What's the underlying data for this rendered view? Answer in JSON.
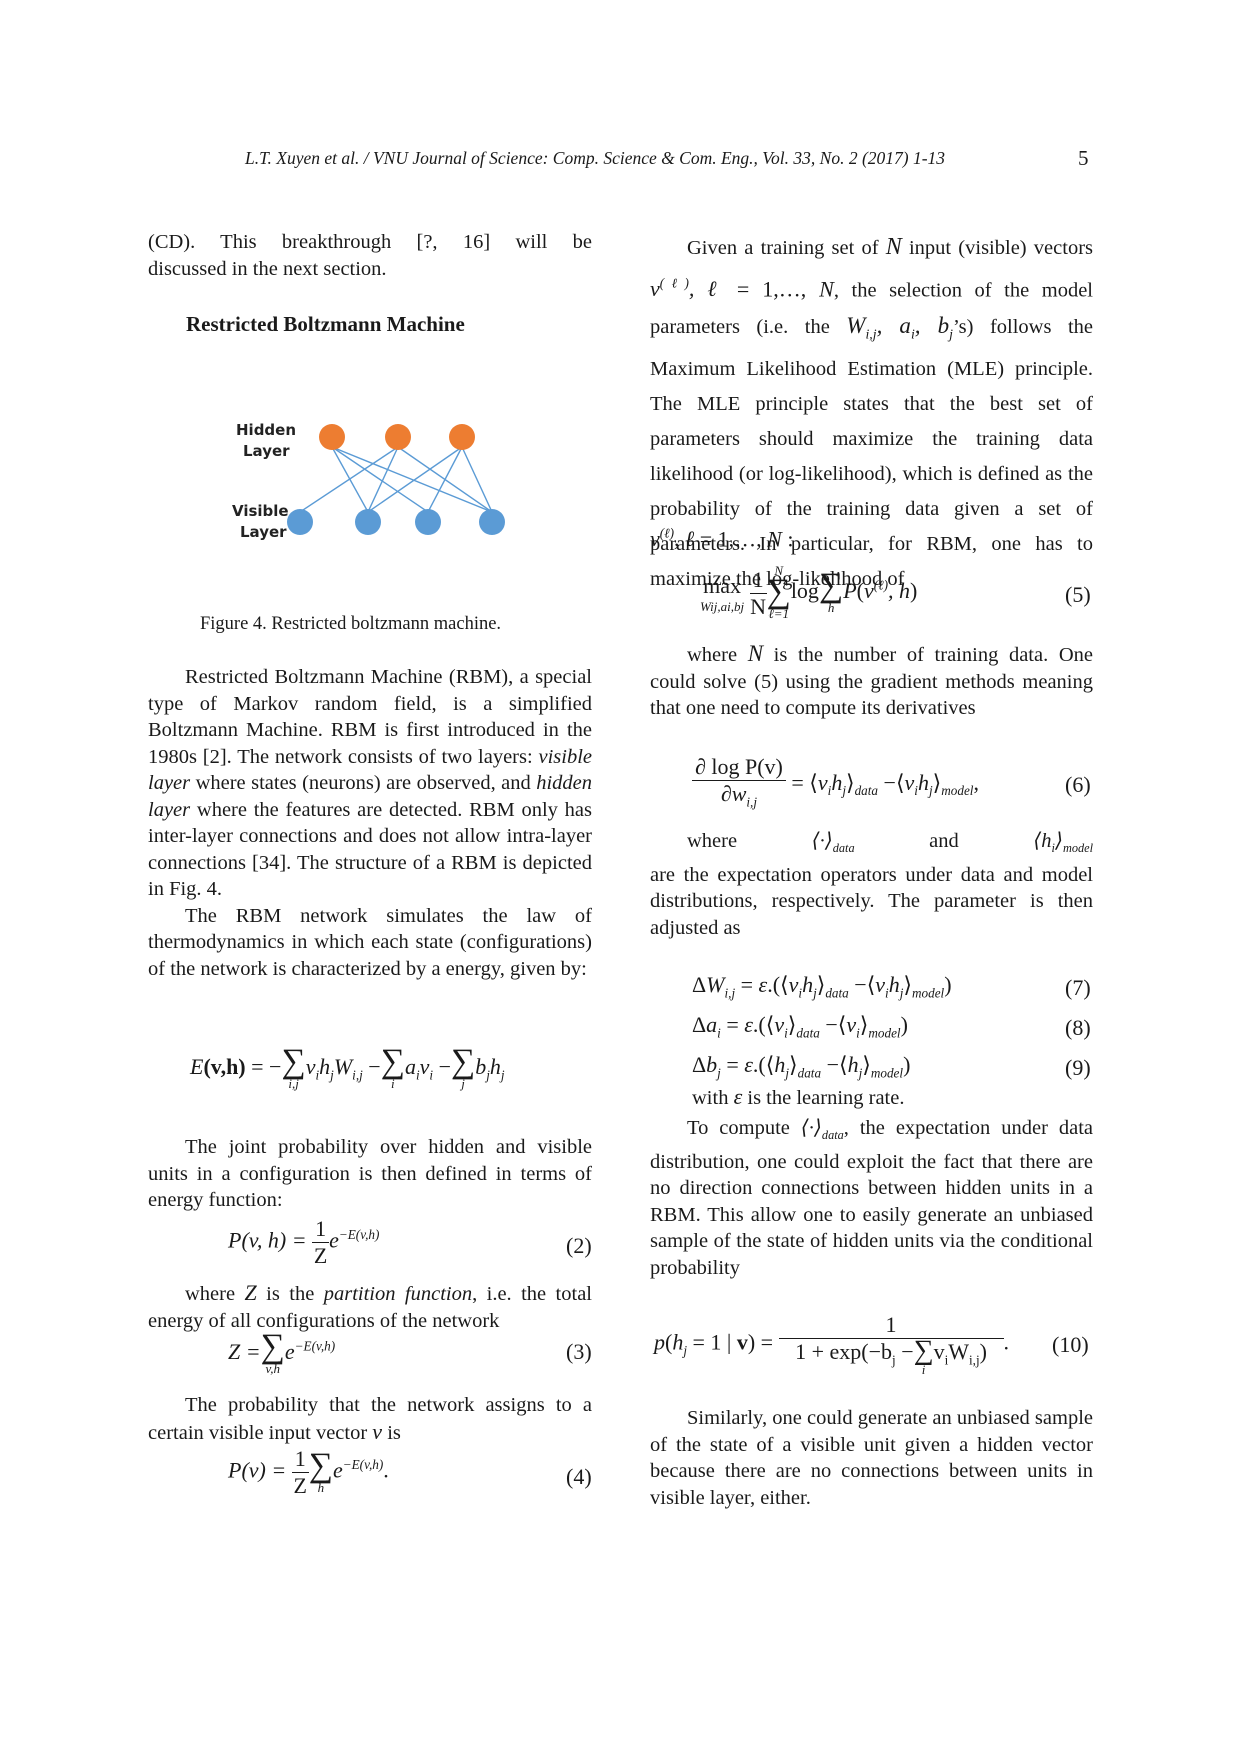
{
  "header": {
    "running_title": "L.T. Xuyen et al. / VNU Journal of Science: Comp. Science & Com. Eng., Vol. 33, No. 2 (2017) 1-13",
    "page_number": "5"
  },
  "left_column": {
    "intro_lines": [
      "(CD). This breakthrough [?, 16] will be",
      "discussed in the next section."
    ],
    "section_heading": "Restricted Boltzmann Machine",
    "figure": {
      "hidden_label_1": "Hidden",
      "hidden_label_2": "Layer",
      "visible_label_1": "Visible",
      "visible_label_2": "Layer",
      "hidden_color": "#ED7D31",
      "visible_color": "#5B9BD5",
      "edge_color": "#5B9BD5",
      "caption": "Figure  4. Restricted boltzmann machine."
    },
    "para_rbm": {
      "t1": "Restricted Boltzmann Machine (RBM), a special type of Markov random field, is a simplified Boltzmann Machine. RBM is first introduced in the 1980s [2]. The network consists of two layers: ",
      "em1": "visible layer",
      "t2": " where states (neurons) are observed, and ",
      "em2": "hidden layer",
      "t3": " where the features are detected. RBM only has inter-layer connections and does not allow intra-layer connections [34]. The structure of a RBM is depicted in Fig. 4."
    },
    "para_thermo": "The RBM network simulates the law of thermodynamics in which each state (configurations) of the network is characterized by a energy, given by:",
    "eq_energy": {
      "lhs": "E",
      "lhs_args": "(v,h)",
      "sum1_sub": "i,j",
      "sum2_sub": "i",
      "sum3_sub": "j"
    },
    "para_joint": "The joint probability over hidden and visible units in a configuration is then defined in terms of energy function:",
    "eq2": {
      "lhs": "P(v, h) =",
      "num": "1",
      "den": "Z",
      "exp": "−E(v,h)",
      "number": "(2)"
    },
    "para_where_z": {
      "t1": "where ",
      "var": "Z",
      "t2": " is the ",
      "em": "partition function",
      "t3": ", i.e. the total energy of all configurations of the network"
    },
    "eq3": {
      "lhs": "Z =",
      "sum_sub": "v,h",
      "exp": "−E(v,h)",
      "number": "(3)"
    },
    "para_prob": {
      "t1": "The probability that the network assigns to a certain visible input vector ",
      "var": "v",
      "t2": " is"
    },
    "eq4": {
      "lhs": "P(v) =",
      "num": "1",
      "den": "Z",
      "sum_sub": "h",
      "exp": "−E(v,h)",
      "number": "(4)"
    }
  },
  "right_column": {
    "para_given": {
      "t1": "Given a training set of ",
      "N": "N",
      "t2": " input (visible) vectors ",
      "t3": ", the selection of the model parameters (i.e. the ",
      "t4": "’s) follows the Maximum Likelihood Estimation (MLE) principle. The MLE principle states that the best set of parameters should maximize the training data likelihood (or log-likelihood), which is defined as the probability of the training data given a set of parameters. In particular, for RBM, one has to maximize the log-likelihood of"
    },
    "eq5": {
      "max": "max",
      "max_sub": "Wij,ai,bj",
      "num": "1",
      "den": "N",
      "sum_top": "N",
      "sum_sub": "ℓ=1",
      "log": "log",
      "sum2_sub": "h",
      "body": "P(v(ℓ), h)",
      "number": "(5)"
    },
    "para_where_n": {
      "t1": "where ",
      "N": "N",
      "t2": " is the number of training data. One could solve (5) using the gradient methods meaning that one need to compute its derivatives"
    },
    "eq6": {
      "num": "∂ log P(v)",
      "den": "∂w",
      "rhs_data": "data",
      "rhs_model": "model",
      "number": "(6)"
    },
    "para_where_op": {
      "t1": "where",
      "t2": "and",
      "t3": "are the expectation operators under data and model distributions, respectively. The parameter is then adjusted as"
    },
    "eq7": {
      "number": "(7)"
    },
    "eq8": {
      "number": "(8)"
    },
    "eq9": {
      "number": "(9)"
    },
    "para_with": {
      "t1": "with ",
      "eps": "ε",
      "t2": " is the learning rate."
    },
    "para_compute": {
      "t1": "To compute ",
      "t2": ", the expectation under data distribution, one could exploit the fact that there are no direction connections between hidden units in a RBM. This allow one to easily generate an unbiased sample of the state of hidden units via the conditional probability"
    },
    "eq10": {
      "num": "1",
      "number": "(10)"
    },
    "para_similarly": "Similarly, one could generate an unbiased sample of the state of a visible unit given a hidden vector because there are no connections between units in visible layer, either."
  }
}
